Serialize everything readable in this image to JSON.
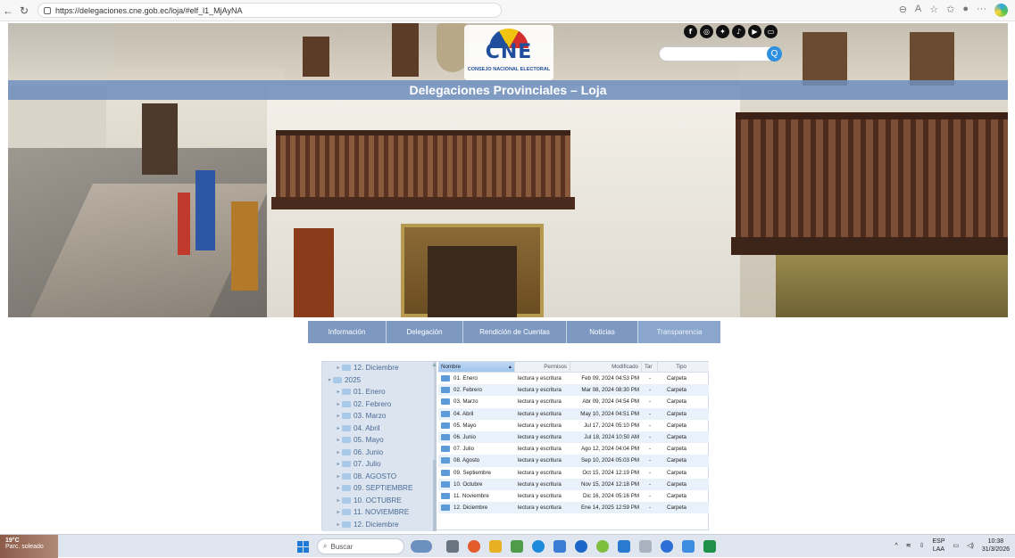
{
  "browser": {
    "url": "https://delegaciones.cne.gob.ec/loja/#elf_l1_MjAyNA"
  },
  "header": {
    "logo_mark": "CNE",
    "logo_sub": "CONSEJO NACIONAL ELECTORAL",
    "title": "Delegaciones Provinciales – Loja",
    "search_icon": "Q",
    "social_icons": [
      "facebook-icon",
      "instagram-icon",
      "twitter-icon",
      "tiktok-icon",
      "youtube-icon",
      "flickr-icon"
    ]
  },
  "menu": {
    "items": [
      {
        "label": "Información"
      },
      {
        "label": "Delegación"
      },
      {
        "label": "Rendición de Cuentas"
      },
      {
        "label": "Noticias"
      },
      {
        "label": "Transparencia"
      }
    ]
  },
  "file_manager": {
    "tree": [
      {
        "label": "12. Diciembre",
        "expanded": false
      },
      {
        "label": "2025",
        "expanded": true
      },
      {
        "label": "01. Enero",
        "expanded": false
      },
      {
        "label": "02. Febrero",
        "expanded": false
      },
      {
        "label": "03. Marzo",
        "expanded": false
      },
      {
        "label": "04. Abril",
        "expanded": false
      },
      {
        "label": "05. Mayo",
        "expanded": false
      },
      {
        "label": "06. Junio",
        "expanded": false
      },
      {
        "label": "07. Julio",
        "expanded": false
      },
      {
        "label": "08. AGOSTO",
        "expanded": false
      },
      {
        "label": "09. SEPTIEMBRE",
        "expanded": false
      },
      {
        "label": "10. OCTUBRE",
        "expanded": false
      },
      {
        "label": "11. NOVIEMBRE",
        "expanded": false
      },
      {
        "label": "12. Diciembre",
        "expanded": false
      }
    ],
    "columns": {
      "name": "Nombre",
      "permissions": "Permisos",
      "modified": "Modificado",
      "size": "Tar",
      "type": "Tipo"
    },
    "rows": [
      {
        "name": "01. Enero",
        "perm": "lectura y escritura",
        "mod": "Feb 09, 2024 04:53 PM",
        "size": "-",
        "type": "Carpeta"
      },
      {
        "name": "02. Febrero",
        "perm": "lectura y escritura",
        "mod": "Mar 08, 2024 08:30 PM",
        "size": "-",
        "type": "Carpeta"
      },
      {
        "name": "03. Marzo",
        "perm": "lectura y escritura",
        "mod": "Abr 09, 2024 04:54 PM",
        "size": "-",
        "type": "Carpeta"
      },
      {
        "name": "04. Abril",
        "perm": "lectura y escritura",
        "mod": "May 10, 2024 04:51 PM",
        "size": "-",
        "type": "Carpeta"
      },
      {
        "name": "05. Mayo",
        "perm": "lectura y escritura",
        "mod": "Jul 17, 2024 05:10 PM",
        "size": "-",
        "type": "Carpeta"
      },
      {
        "name": "06. Junio",
        "perm": "lectura y escritura",
        "mod": "Jul 18, 2024 10:50 AM",
        "size": "-",
        "type": "Carpeta"
      },
      {
        "name": "07. Julio",
        "perm": "lectura y escritura",
        "mod": "Ago 12, 2024 04:04 PM",
        "size": "-",
        "type": "Carpeta"
      },
      {
        "name": "08. Agosto",
        "perm": "lectura y escritura",
        "mod": "Sep 10, 2024 05:03 PM",
        "size": "-",
        "type": "Carpeta"
      },
      {
        "name": "09. Septiembre",
        "perm": "lectura y escritura",
        "mod": "Oct 15, 2024 12:19 PM",
        "size": "-",
        "type": "Carpeta"
      },
      {
        "name": "10. Octubre",
        "perm": "lectura y escritura",
        "mod": "Nov 15, 2024 12:18 PM",
        "size": "-",
        "type": "Carpeta"
      },
      {
        "name": "11. Noviembre",
        "perm": "lectura y escritura",
        "mod": "Dic 16, 2024 05:16 PM",
        "size": "-",
        "type": "Carpeta"
      },
      {
        "name": "12. Diciembre",
        "perm": "lectura y escritura",
        "mod": "Ene 14, 2025 12:59 PM",
        "size": "-",
        "type": "Carpeta"
      }
    ]
  },
  "taskbar": {
    "weather_temp": "19°C",
    "weather_text": "Parc. soleado",
    "search_placeholder": "Buscar",
    "lang_top": "ESP",
    "lang_bottom": "LAA",
    "time": "10:38",
    "date": "31/3/2026"
  },
  "colors": {
    "title_bar": "#6f8fbc",
    "menu_bg": "#7d99c1",
    "accent_blue": "#2f8fe0"
  }
}
